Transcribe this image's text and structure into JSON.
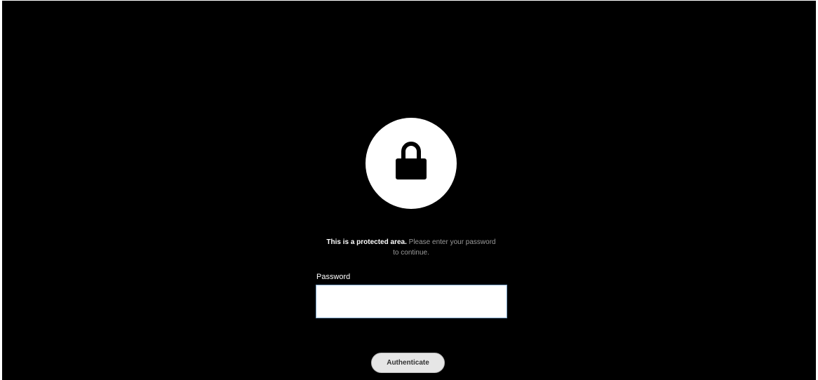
{
  "lock": {
    "icon": "lock-icon"
  },
  "message": {
    "bold": "This is a protected area.",
    "rest": " Please enter your password to continue."
  },
  "form": {
    "password_label": "Password",
    "password_value": "",
    "button_label": "Authenticate"
  },
  "colors": {
    "background": "#000000",
    "circle": "#ffffff",
    "button_bg": "#e6e6e6",
    "input_border": "#7aa3c8"
  }
}
